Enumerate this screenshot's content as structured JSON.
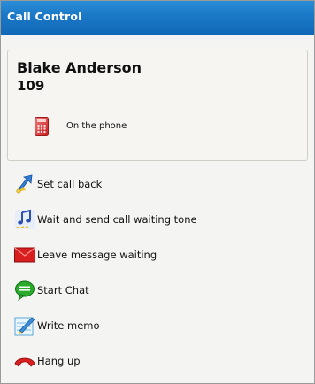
{
  "window": {
    "title": "Call Control"
  },
  "contact": {
    "name": "Blake Anderson",
    "extension": "109",
    "status": "On the phone",
    "status_icon": "red-phone-icon"
  },
  "actions": [
    {
      "label": "Set call back",
      "icon": "callback-arrow-icon"
    },
    {
      "label": "Wait and send call waiting tone",
      "icon": "music-note-icon"
    },
    {
      "label": "Leave message waiting",
      "icon": "envelope-icon"
    },
    {
      "label": "Start Chat",
      "icon": "chat-bubble-icon"
    },
    {
      "label": "Write memo",
      "icon": "memo-icon"
    },
    {
      "label": "Hang up",
      "icon": "hang-up-icon"
    }
  ],
  "colors": {
    "titlebar": "#1a78c6",
    "card_background": "#f6f5f2",
    "window_background": "#f4f4f2",
    "status_phone": "#e04040"
  }
}
